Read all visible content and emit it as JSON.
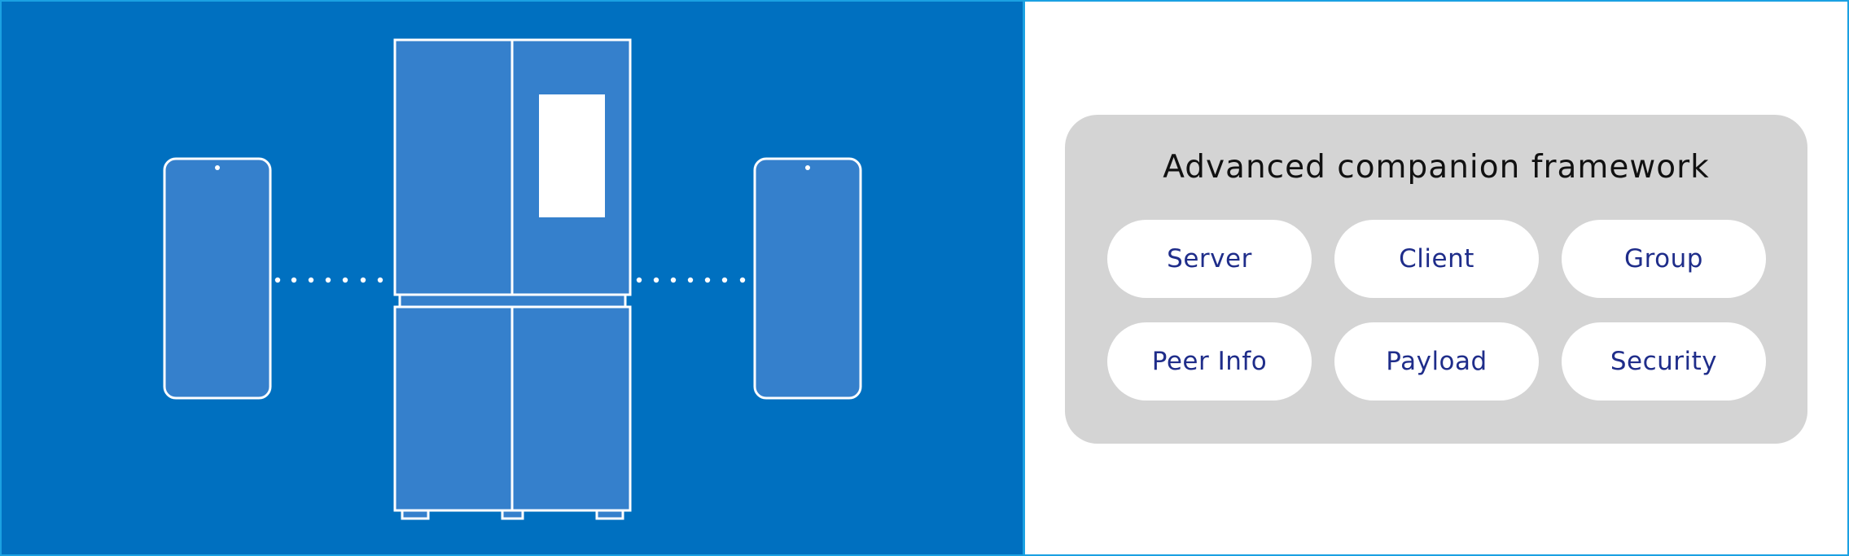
{
  "colors": {
    "left_background": "#0070c0",
    "device_fill": "#3580cc",
    "outline": "#ffffff",
    "framework_background": "#d4d4d4",
    "pill_text": "#1f2d8a",
    "border_accent": "#1ba1e2"
  },
  "icons": [
    "smartphone-left-icon",
    "refrigerator-icon",
    "smartphone-right-icon",
    "connection-dots-icon"
  ],
  "framework": {
    "title": "Advanced companion framework",
    "modules": [
      "Server",
      "Client",
      "Group",
      "Peer Info",
      "Payload",
      "Security"
    ]
  }
}
